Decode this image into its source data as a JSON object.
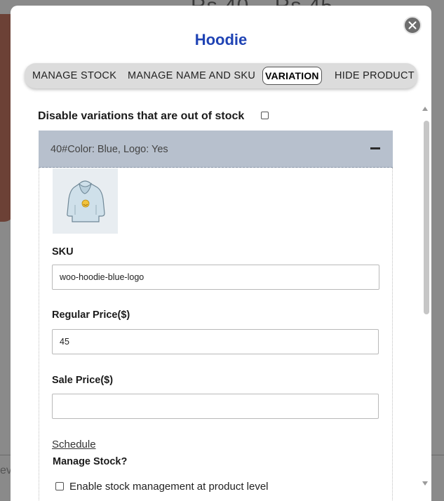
{
  "background": {
    "price_text": "Rs 40 – Rs 45",
    "bottom_text": "evi"
  },
  "modal": {
    "title": "Hoodie",
    "close_icon": "close-icon",
    "tabs": [
      {
        "label": "MANAGE STOCK",
        "active": false
      },
      {
        "label": "MANAGE NAME AND SKU",
        "active": false
      },
      {
        "label": "VARIATION",
        "active": true
      },
      {
        "label": "HIDE PRODUCT",
        "active": false
      }
    ],
    "disable_out_of_stock": {
      "label": "Disable variations that are out of stock",
      "checked": false
    },
    "variation": {
      "header": "40#Color: Blue, Logo: Yes",
      "collapse_icon": "minus-icon",
      "image_alt": "hoodie-thumbnail",
      "sku_label": "SKU",
      "sku_value": "woo-hoodie-blue-logo",
      "regular_price_label": "Regular Price($)",
      "regular_price_value": "45",
      "sale_price_label": "Sale Price($)",
      "sale_price_value": "",
      "schedule_link": "Schedule",
      "manage_stock_label": "Manage Stock?",
      "enable_stock_label": "Enable stock management at product level",
      "enable_stock_checked": false
    }
  },
  "colors": {
    "title": "#1f43b4",
    "variation_header_bg": "#b7c0cd",
    "tabs_bg": "#dcdcdc"
  }
}
